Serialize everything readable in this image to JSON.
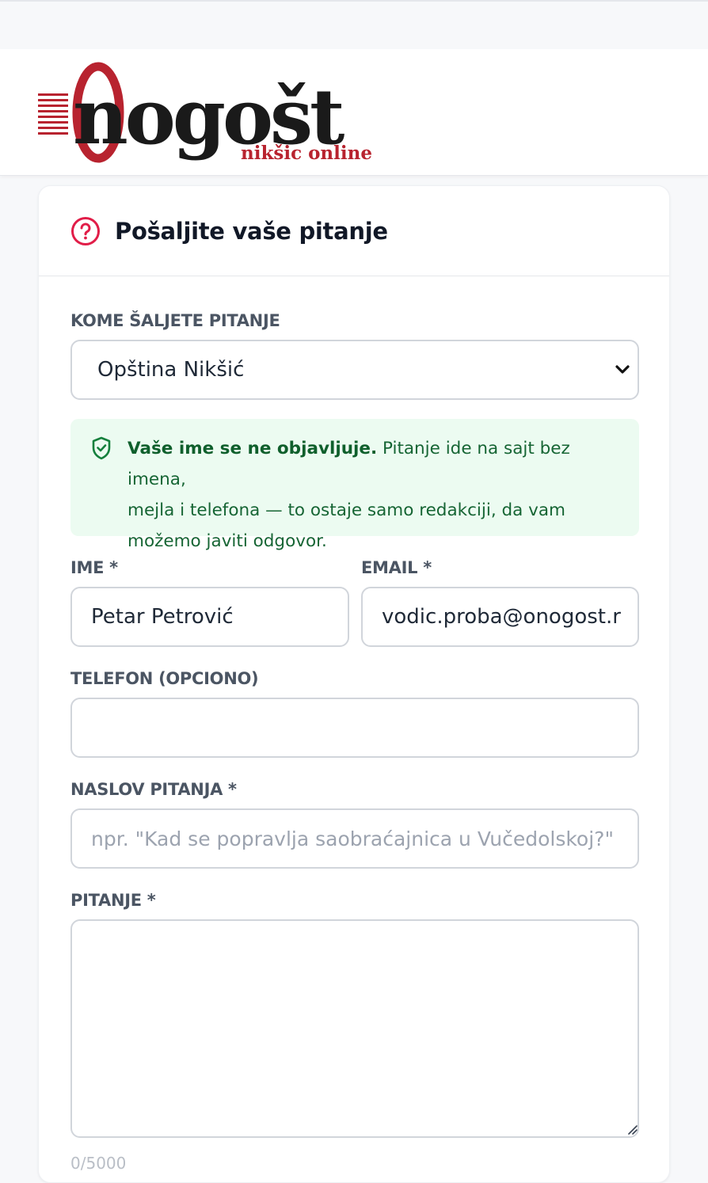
{
  "header": {
    "logo": {
      "wordmark": "onogošt",
      "tagline": "nikšic online"
    }
  },
  "form": {
    "title": "Pošaljite vaše pitanje",
    "recipient": {
      "label": "KOME ŠALJETE PITANJE",
      "value": "Opština Nikšić"
    },
    "privacy_notice": {
      "bold": "Vaše ime se ne objavljuje.",
      "line1": " Pitanje ide na sajt bez imena,",
      "line2": "mejla i telefona — to ostaje samo redakciji, da vam",
      "line3": "možemo javiti odgovor."
    },
    "name": {
      "label": "IME *",
      "value": "Petar Petrović"
    },
    "email": {
      "label": "EMAIL *",
      "value": "vodic.proba@onogost.r"
    },
    "phone": {
      "label": "TELEFON (OPCIONO)",
      "value": ""
    },
    "subject": {
      "label": "NASLOV PITANJA *",
      "placeholder": "npr. \"Kad se popravlja saobraćajnica u Vučedolskoj?\""
    },
    "question": {
      "label": "PITANJE *",
      "value": ""
    },
    "counter": "0/5000"
  },
  "colors": {
    "accent": "#e11d48",
    "brand_red": "#b8232f",
    "notice_bg": "#ecfbf1",
    "notice_text": "#166534"
  },
  "icons": {
    "title_icon": "question-circle-icon",
    "notice_icon": "shield-check-icon",
    "select_icon": "chevron-down-icon"
  }
}
